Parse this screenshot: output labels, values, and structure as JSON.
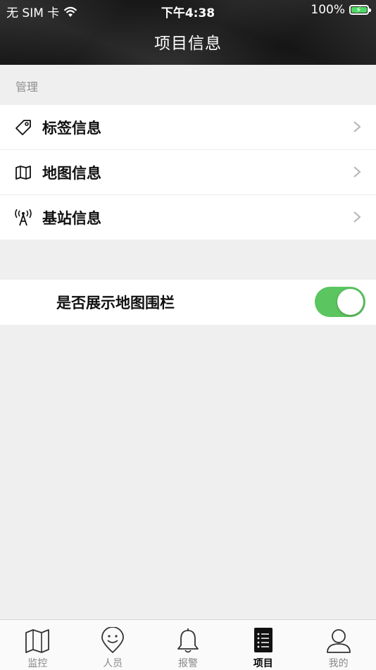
{
  "status_bar": {
    "carrier": "无 SIM 卡",
    "time": "下午4:38",
    "battery": "100%"
  },
  "header": {
    "title": "项目信息"
  },
  "section": {
    "label": "管理"
  },
  "menu": {
    "items": [
      {
        "label": "标签信息",
        "icon": "tag-icon"
      },
      {
        "label": "地图信息",
        "icon": "map-icon"
      },
      {
        "label": "基站信息",
        "icon": "antenna-icon"
      }
    ]
  },
  "fence_toggle": {
    "label": "是否展示地图围栏",
    "on": true
  },
  "tabbar": {
    "items": [
      {
        "label": "监控",
        "icon": "map-icon",
        "active": false
      },
      {
        "label": "人员",
        "icon": "person-pin-icon",
        "active": false
      },
      {
        "label": "报警",
        "icon": "bell-icon",
        "active": false
      },
      {
        "label": "项目",
        "icon": "list-icon",
        "active": true
      },
      {
        "label": "我的",
        "icon": "user-icon",
        "active": false
      }
    ]
  },
  "colors": {
    "accent_green": "#5bc560",
    "battery_green": "#4cd964"
  }
}
